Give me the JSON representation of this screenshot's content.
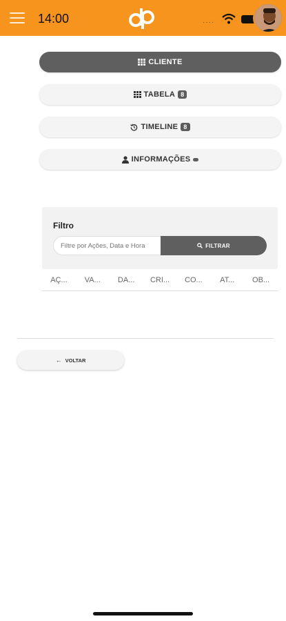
{
  "status_bar": {
    "time": "14:00",
    "signal": "····"
  },
  "nav": {
    "cliente": {
      "label": "CLIENTE"
    },
    "tabela": {
      "label": "TABELA",
      "badge": "8"
    },
    "timeline": {
      "label": "TIMELINE",
      "badge": "8"
    },
    "informacoes": {
      "label": "INFORMAÇÕES"
    }
  },
  "filter": {
    "title": "Filtro",
    "placeholder": "Filtre por Ações, Data e Hora",
    "button_label": "FILTRAR"
  },
  "table": {
    "columns": [
      "AÇ...",
      "VA...",
      "DA...",
      "CRI...",
      "CO...",
      "AT...",
      "OB..."
    ]
  },
  "back_button": {
    "label": "VOLTAR"
  },
  "colors": {
    "brand": "#f7941d",
    "active_button": "#5f5f5f"
  }
}
